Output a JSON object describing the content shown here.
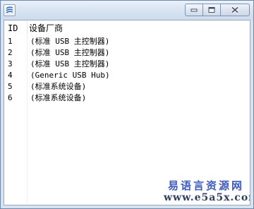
{
  "window": {
    "icon": "app-logo-icon",
    "buttons": [
      "minimize-icon",
      "maximize-icon",
      "close-icon"
    ]
  },
  "list": {
    "columns": [
      "ID",
      "设备厂商"
    ],
    "rows": [
      {
        "id": "1",
        "vendor": "(标准 USB 主控制器)"
      },
      {
        "id": "2",
        "vendor": "(标准 USB 主控制器)"
      },
      {
        "id": "3",
        "vendor": "(标准 USB 主控制器)"
      },
      {
        "id": "4",
        "vendor": "(Generic USB Hub)"
      },
      {
        "id": "5",
        "vendor": "(标准系统设备)"
      },
      {
        "id": "6",
        "vendor": "(标准系统设备)"
      }
    ]
  },
  "watermark": {
    "line1": "易语言资源网",
    "line2": "www.e5a5x.com"
  }
}
